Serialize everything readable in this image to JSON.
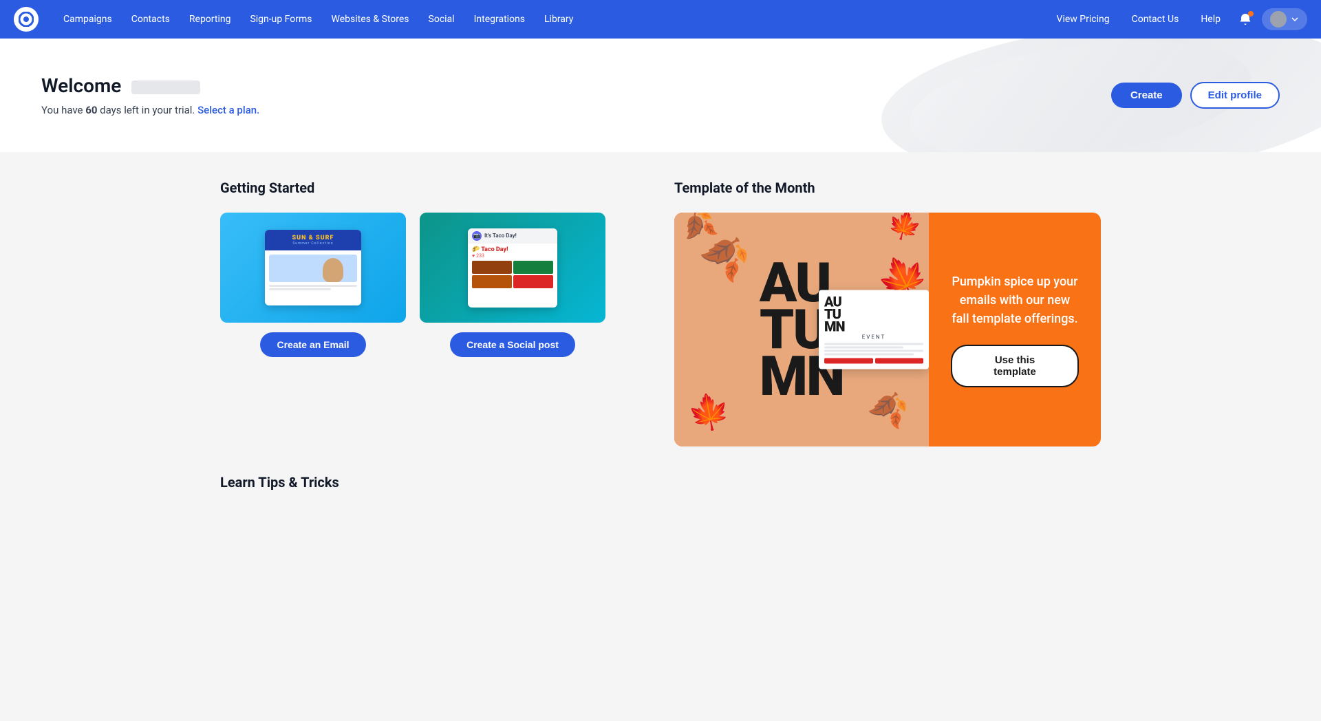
{
  "nav": {
    "links_left": [
      {
        "label": "Campaigns",
        "name": "campaigns"
      },
      {
        "label": "Contacts",
        "name": "contacts"
      },
      {
        "label": "Reporting",
        "name": "reporting"
      },
      {
        "label": "Sign-up Forms",
        "name": "signup-forms"
      },
      {
        "label": "Websites & Stores",
        "name": "websites-stores"
      },
      {
        "label": "Social",
        "name": "social"
      },
      {
        "label": "Integrations",
        "name": "integrations"
      },
      {
        "label": "Library",
        "name": "library"
      }
    ],
    "links_right": [
      {
        "label": "View Pricing",
        "name": "view-pricing"
      },
      {
        "label": "Contact Us",
        "name": "contact-us"
      },
      {
        "label": "Help",
        "name": "help"
      }
    ]
  },
  "hero": {
    "welcome_prefix": "Welcome",
    "trial_text_pre": "You have ",
    "trial_days": "60",
    "trial_text_post": " days left in your trial.",
    "plan_link": "Select a plan.",
    "create_button": "Create",
    "edit_profile_button": "Edit profile"
  },
  "getting_started": {
    "title": "Getting Started",
    "email_card": {
      "button": "Create an Email"
    },
    "social_card": {
      "button": "Create a Social post"
    }
  },
  "template_month": {
    "title": "Template of the Month",
    "description": "Pumpkin spice up your emails with our new fall template offerings.",
    "use_template_button": "Use this template",
    "autumn_text": "AU\nTU\nMN",
    "inner_text": "AU\nTU\nMN",
    "event_label": "EVENT"
  },
  "learn_tips": {
    "title": "Learn Tips & Tricks"
  }
}
